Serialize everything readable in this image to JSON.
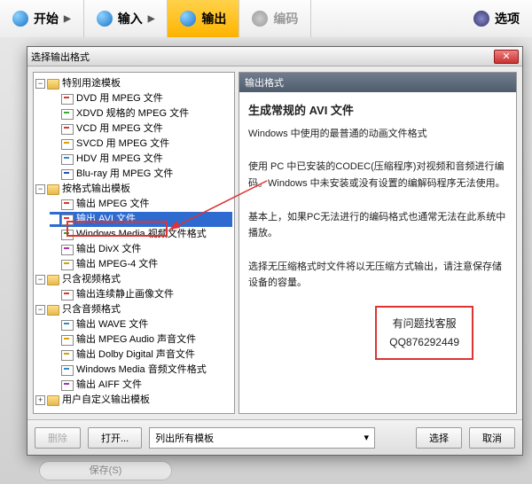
{
  "topbar": {
    "tabs": [
      {
        "label": "开始"
      },
      {
        "label": "输入"
      },
      {
        "label": "输出"
      },
      {
        "label": "编码"
      },
      {
        "label": "选项"
      }
    ]
  },
  "dialog": {
    "title": "选择输出格式",
    "close": "✕"
  },
  "tree": {
    "n0": {
      "label": "特别用途模板"
    },
    "n0c": [
      {
        "label": "DVD 用 MPEG 文件",
        "c": "#d33"
      },
      {
        "label": "XDVD 规格的 MPEG 文件",
        "c": "#3a3"
      },
      {
        "label": "VCD 用 MPEG 文件",
        "c": "#d33"
      },
      {
        "label": "SVCD 用 MPEG 文件",
        "c": "#d8a000"
      },
      {
        "label": "HDV 用 MPEG 文件",
        "c": "#38c"
      },
      {
        "label": "Blu-ray 用 MPEG 文件",
        "c": "#25a"
      }
    ],
    "n1": {
      "label": "按格式输出模板"
    },
    "n1c": [
      {
        "label": "输出 MPEG 文件",
        "c": "#d33"
      },
      {
        "label": "输出 AVI 文件",
        "c": "#d33",
        "sel": true
      },
      {
        "label": "Windows Media 视频文件格式",
        "c": "#3a3"
      },
      {
        "label": "输出 DivX 文件",
        "c": "#a3a"
      },
      {
        "label": "输出 MPEG-4 文件",
        "c": "#d8a000"
      }
    ],
    "n2": {
      "label": "只含视频格式"
    },
    "n2c": [
      {
        "label": "输出连续静止画像文件",
        "c": "#d33"
      }
    ],
    "n3": {
      "label": "只含音频格式"
    },
    "n3c": [
      {
        "label": "输出 WAVE 文件",
        "c": "#38c"
      },
      {
        "label": "输出 MPEG Audio 声音文件",
        "c": "#d8a000"
      },
      {
        "label": "输出 Dolby Digital 声音文件",
        "c": "#d8a000"
      },
      {
        "label": "Windows Media 音频文件格式",
        "c": "#38c"
      },
      {
        "label": "输出 AIFF 文件",
        "c": "#a3a"
      }
    ],
    "n4": {
      "label": "用户自定义输出模板"
    }
  },
  "desc": {
    "head": "输出格式",
    "title": "生成常规的 AVI 文件",
    "p1": "Windows 中使用的最普通的动画文件格式",
    "p2": "使用 PC 中已安装的CODEC(压缩程序)对视频和音频进行编码。Windows 中未安装或没有设置的编解码程序无法使用。",
    "p3": "基本上，如果PC无法进行的编码格式也通常无法在此系统中播放。",
    "p4": "选择无压缩格式时文件将以无压缩方式输出，请注意保存储设备的容量。",
    "qq1": "有问题找客服",
    "qq2": "QQ876292449"
  },
  "footer": {
    "delete": "删除",
    "open": "打开...",
    "combo": "列出所有模板",
    "select": "选择",
    "cancel": "取消"
  },
  "extra": {
    "save": "保存(S)"
  }
}
